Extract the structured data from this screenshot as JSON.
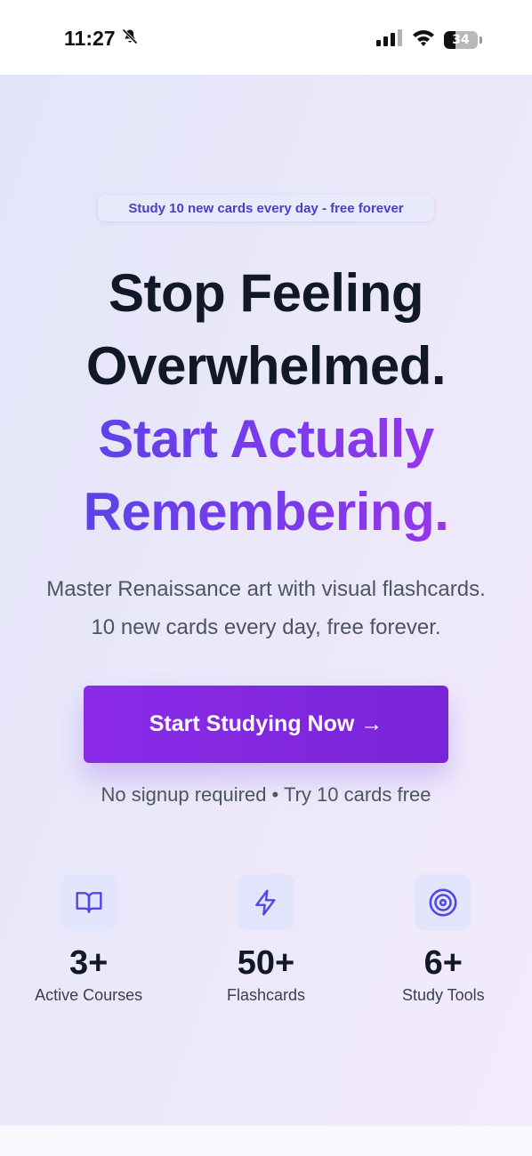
{
  "status_bar": {
    "time": "11:27",
    "battery": "34",
    "icons": [
      "bell-slash-icon",
      "signal-icon",
      "wifi-icon",
      "battery-icon"
    ]
  },
  "hero": {
    "badge": "Study 10 new cards every day - free forever",
    "headline_line1": "Stop Feeling",
    "headline_line2": "Overwhelmed.",
    "headline_line3": "Start Actually",
    "headline_line4": "Remembering.",
    "subtitle_line1": "Master Renaissance art with visual flashcards.",
    "subtitle_line2": "10 new cards every day, free forever.",
    "cta_label": "Start Studying Now →",
    "note": "No signup required • Try 10 cards free"
  },
  "stats": [
    {
      "icon": "book-open-icon",
      "value": "3+",
      "label": "Active Courses"
    },
    {
      "icon": "lightning-icon",
      "value": "50+",
      "label": "Flashcards"
    },
    {
      "icon": "target-icon",
      "value": "6+",
      "label": "Study Tools"
    }
  ],
  "colors": {
    "accent": "#7c3aed",
    "badge_text": "#4b3fc6",
    "heading": "#111827",
    "body_text": "#4b5563"
  }
}
